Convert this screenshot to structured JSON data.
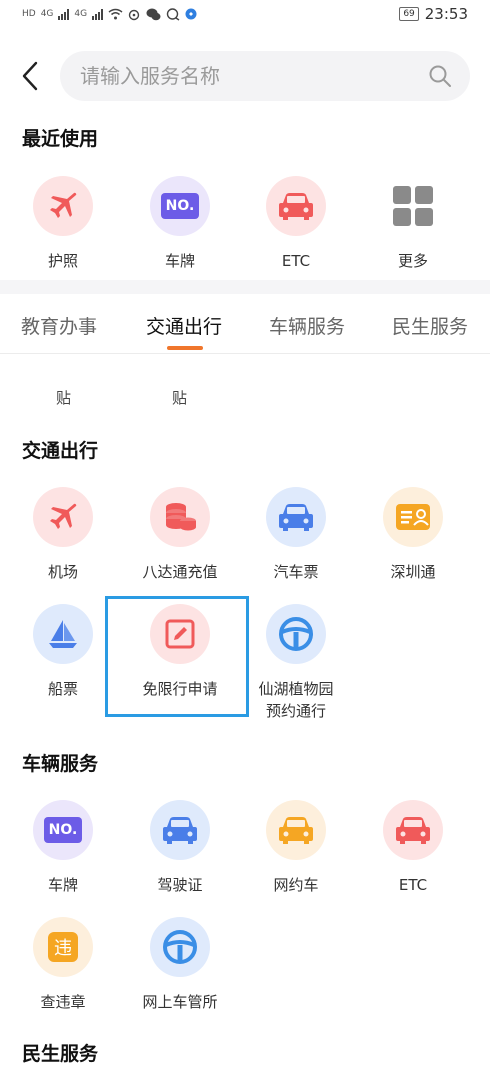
{
  "status_bar": {
    "left_labels": [
      "HD",
      "4G",
      "4G"
    ],
    "battery": "69",
    "time": "23:53"
  },
  "search": {
    "placeholder": "请输入服务名称"
  },
  "recent": {
    "title": "最近使用",
    "items": [
      {
        "label": "护照",
        "icon": "airplane-icon",
        "badge": ""
      },
      {
        "label": "车牌",
        "icon": "license-plate-icon",
        "badge": "NO."
      },
      {
        "label": "ETC",
        "icon": "car-icon",
        "badge": ""
      },
      {
        "label": "更多",
        "icon": "more-grid-icon",
        "badge": ""
      }
    ]
  },
  "tabs": [
    {
      "label": "教育办事",
      "active": false
    },
    {
      "label": "交通出行",
      "active": true
    },
    {
      "label": "车辆服务",
      "active": false
    },
    {
      "label": "民生服务",
      "active": false
    }
  ],
  "clipped_row": [
    "贴",
    "贴"
  ],
  "traffic": {
    "title": "交通出行",
    "items": [
      {
        "label": "机场",
        "icon": "airplane-icon",
        "badge": ""
      },
      {
        "label": "八达通充值",
        "icon": "coins-stack-icon",
        "badge": ""
      },
      {
        "label": "汽车票",
        "icon": "bus-icon",
        "badge": ""
      },
      {
        "label": "深圳通",
        "icon": "card-icon",
        "badge": ""
      },
      {
        "label": "船票",
        "icon": "sailboat-icon",
        "badge": ""
      },
      {
        "label": "免限行申请",
        "icon": "edit-form-icon",
        "badge": ""
      },
      {
        "label": "仙湖植物园\n预约通行",
        "label_line1": "仙湖植物园",
        "label_line2": "预约通行",
        "icon": "steering-wheel-icon",
        "badge": ""
      }
    ]
  },
  "vehicle": {
    "title": "车辆服务",
    "items": [
      {
        "label": "车牌",
        "icon": "license-plate-icon",
        "badge": "NO."
      },
      {
        "label": "驾驶证",
        "icon": "car-icon",
        "badge": ""
      },
      {
        "label": "网约车",
        "icon": "taxi-icon",
        "badge": ""
      },
      {
        "label": "ETC",
        "icon": "car-icon",
        "badge": ""
      },
      {
        "label": "查违章",
        "icon": "violation-icon",
        "badge": "违"
      },
      {
        "label": "网上车管所",
        "icon": "steering-wheel-icon",
        "badge": ""
      }
    ]
  },
  "livelihood": {
    "title": "民生服务"
  },
  "colors": {
    "accent": "#f0762c",
    "highlight": "#2a9be3",
    "red": "#f05a5a",
    "purple": "#6c5ce7",
    "blue": "#4a7ee8",
    "orange": "#f5a623"
  }
}
